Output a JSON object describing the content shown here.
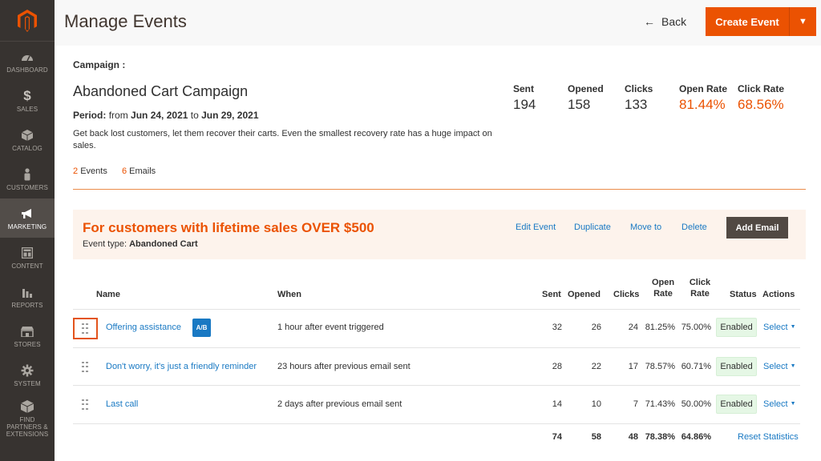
{
  "sidebar": {
    "items": [
      {
        "label": "DASHBOARD",
        "icon": "dashboard-icon"
      },
      {
        "label": "SALES",
        "icon": "dollar-icon"
      },
      {
        "label": "CATALOG",
        "icon": "box-icon"
      },
      {
        "label": "CUSTOMERS",
        "icon": "person-icon"
      },
      {
        "label": "MARKETING",
        "icon": "megaphone-icon"
      },
      {
        "label": "CONTENT",
        "icon": "layout-icon"
      },
      {
        "label": "REPORTS",
        "icon": "bar-chart-icon"
      },
      {
        "label": "STORES",
        "icon": "store-icon"
      },
      {
        "label": "SYSTEM",
        "icon": "gear-icon"
      },
      {
        "label": "FIND PARTNERS & EXTENSIONS",
        "icon": "cube-icon"
      }
    ]
  },
  "header": {
    "title": "Manage Events",
    "back_label": "Back",
    "create_label": "Create Event"
  },
  "campaign": {
    "label": "Campaign :",
    "name": "Abandoned Cart Campaign",
    "period_prefix": "Period:",
    "period_from_word": "from",
    "period_from": "Jun 24, 2021",
    "period_to_word": "to",
    "period_to": "Jun 29, 2021",
    "description": "Get back lost customers, let them recover their carts. Even the smallest recovery rate has a huge impact on sales.",
    "events_count": "2",
    "events_label": "Events",
    "emails_count": "6",
    "emails_label": "Emails",
    "stats": {
      "sent_label": "Sent",
      "sent": "194",
      "opened_label": "Opened",
      "opened": "158",
      "clicks_label": "Clicks",
      "clicks": "133",
      "open_rate_label": "Open Rate",
      "open_rate": "81.44%",
      "click_rate_label": "Click Rate",
      "click_rate": "68.56%"
    }
  },
  "event": {
    "title": "For customers with lifetime sales OVER $500",
    "type_label": "Event type:",
    "type_value": "Abandoned Cart",
    "edit": "Edit Event",
    "duplicate": "Duplicate",
    "move": "Move to",
    "delete": "Delete",
    "add_email": "Add Email"
  },
  "table": {
    "headers": {
      "name": "Name",
      "when": "When",
      "sent": "Sent",
      "opened": "Opened",
      "clicks": "Clicks",
      "open_rate_1": "Open",
      "open_rate_2": "Rate",
      "click_rate_1": "Click",
      "click_rate_2": "Rate",
      "status": "Status",
      "actions": "Actions"
    },
    "rows": [
      {
        "name": "Offering assistance",
        "badge": "A/B",
        "when": "1 hour after event triggered",
        "sent": "32",
        "opened": "26",
        "clicks": "24",
        "open_rate": "81.25%",
        "click_rate": "75.00%",
        "status": "Enabled",
        "action": "Select"
      },
      {
        "name": "Don't worry, it's just a friendly reminder",
        "when": "23 hours after previous email sent",
        "sent": "28",
        "opened": "22",
        "clicks": "17",
        "open_rate": "78.57%",
        "click_rate": "60.71%",
        "status": "Enabled",
        "action": "Select"
      },
      {
        "name": "Last call",
        "when": "2 days after previous email sent",
        "sent": "14",
        "opened": "10",
        "clicks": "7",
        "open_rate": "71.43%",
        "click_rate": "50.00%",
        "status": "Enabled",
        "action": "Select"
      }
    ],
    "totals": {
      "sent": "74",
      "opened": "58",
      "clicks": "48",
      "open_rate": "78.38%",
      "click_rate": "64.86%",
      "reset": "Reset Statistics"
    }
  },
  "colors": {
    "accent": "#eb5202",
    "link": "#1979c3",
    "sidebar": "#373330"
  }
}
